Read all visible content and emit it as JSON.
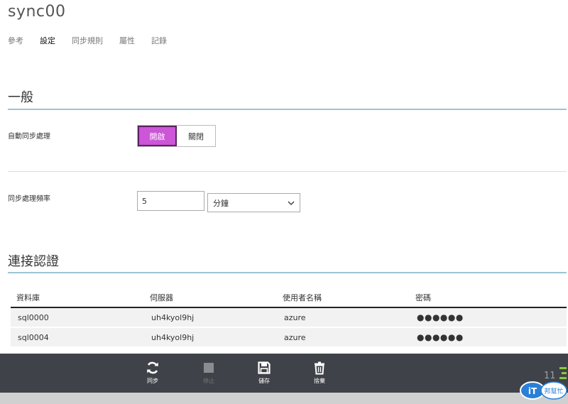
{
  "header": {
    "title": "sync00"
  },
  "tabs": [
    {
      "label": "參考",
      "active": false
    },
    {
      "label": "設定",
      "active": true
    },
    {
      "label": "同步規則",
      "active": false
    },
    {
      "label": "屬性",
      "active": false
    },
    {
      "label": "記錄",
      "active": false
    }
  ],
  "general": {
    "heading": "一般",
    "auto_sync": {
      "label": "自動同步處理",
      "on_label": "開啟",
      "off_label": "關閉",
      "selected": "開啟"
    },
    "frequency": {
      "label": "同步處理頻率",
      "value": "5",
      "unit": "分鐘"
    }
  },
  "credentials": {
    "heading": "連接認證",
    "columns": [
      "資料庫",
      "伺服器",
      "使用者名稱",
      "密碼"
    ],
    "rows": [
      [
        "sql0000",
        "uh4kyol9hj",
        "azure",
        "●●●●●●"
      ],
      [
        "sql0004",
        "uh4kyol9hj",
        "azure",
        "●●●●●●"
      ]
    ]
  },
  "commands": [
    {
      "label": "同步",
      "icon": "sync-icon",
      "enabled": true
    },
    {
      "label": "停止",
      "icon": "stop-icon",
      "enabled": false
    },
    {
      "label": "儲存",
      "icon": "save-icon",
      "enabled": true
    },
    {
      "label": "捨棄",
      "icon": "trash-icon",
      "enabled": true
    }
  ],
  "corner": {
    "count": "11"
  },
  "watermark": {
    "text": "iT邦幫忙"
  },
  "colors": {
    "accent_toggle": "#cc55d8",
    "section_rule": "#9cc4d4",
    "command_bar": "#3f4248"
  }
}
